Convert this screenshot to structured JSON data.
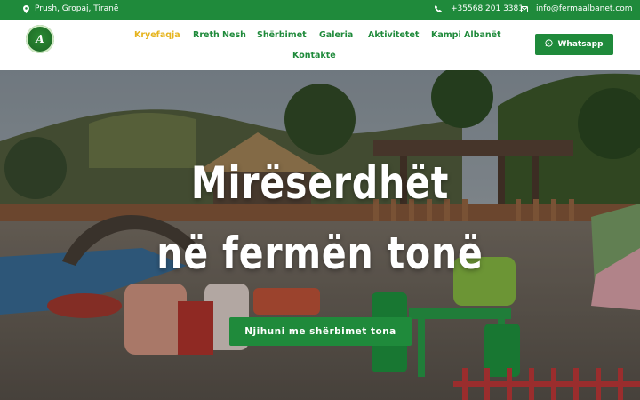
{
  "topbar": {
    "address": "Prush, Gropaj, Tiranë",
    "phone": "+35568 201 3381",
    "email": "info@fermaalbanet.com"
  },
  "logo": {
    "text": "A"
  },
  "nav": {
    "items": [
      {
        "label": "Kryefaqja",
        "active": true
      },
      {
        "label": "Rreth Nesh"
      },
      {
        "label": "Shërbimet"
      },
      {
        "label": "Galeria"
      },
      {
        "label": "Aktivitetet"
      },
      {
        "label": "Kampi Albanët"
      },
      {
        "label": "Kontakte"
      }
    ]
  },
  "whatsapp": {
    "label": "Whatsapp"
  },
  "hero": {
    "title_line1": "Mirëserdhët",
    "title_line2": "në fermën tonë",
    "cta_label": "Njihuni me shërbimet tona"
  },
  "colors": {
    "brand_green": "#1f8a3b",
    "active_nav": "#e6b41e"
  },
  "icons": [
    "location-pin-icon",
    "phone-icon",
    "mail-icon",
    "whatsapp-icon"
  ]
}
